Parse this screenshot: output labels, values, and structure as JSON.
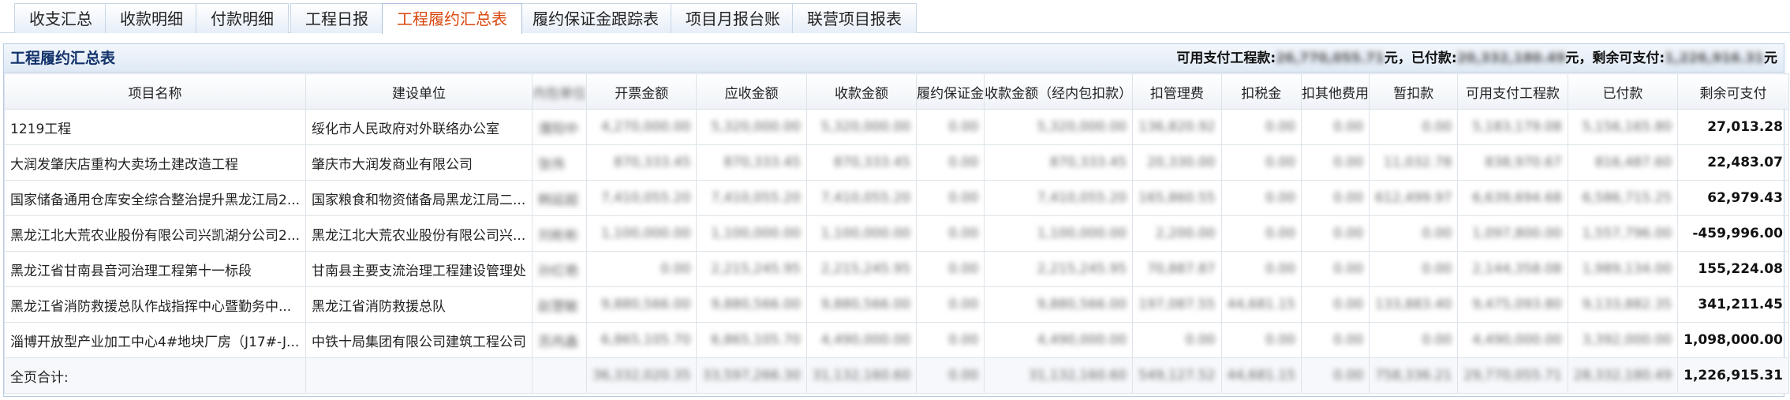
{
  "tabs": [
    {
      "label": "收支汇总",
      "active": false
    },
    {
      "label": "收款明细",
      "active": false
    },
    {
      "label": "付款明细",
      "active": false
    },
    {
      "label": "工程日报",
      "active": false
    },
    {
      "label": "工程履约汇总表",
      "active": true
    },
    {
      "label": "履约保证金跟踪表",
      "active": false
    },
    {
      "label": "项目月报台账",
      "active": false
    },
    {
      "label": "联营项目报表",
      "active": false
    }
  ],
  "panel": {
    "title": "工程履约汇总表",
    "summary": {
      "payable_label": "可用支付工程款:",
      "payable_value": "26,770,055.71",
      "paid_label": "元，已付款:",
      "paid_value": "20,332,180.49",
      "remaining_label": "元，剩余可支付:",
      "remaining_value": "1,226,916.31",
      "unit": "元"
    }
  },
  "table": {
    "columns": [
      "项目名称",
      "建设单位",
      "内包单位",
      "开票金额",
      "应收金额",
      "收款金额",
      "履约保证金",
      "收款金额（经内包扣款）",
      "扣管理费",
      "扣税金",
      "扣其他费用",
      "暂扣款",
      "可用支付工程款",
      "已付款",
      "剩余可支付"
    ],
    "rows": [
      [
        "1219工程",
        "绥化市人民政府对外联络办公室",
        "濮阳中",
        "4,270,000.00",
        "5,320,000.00",
        "5,320,000.00",
        "0.00",
        "5,320,000.00",
        "136,820.92",
        "0.00",
        "0.00",
        "0.00",
        "5,183,179.08",
        "5,156,165.80",
        "27,013.28"
      ],
      [
        "大润发肇庆店重构大卖场土建改造工程",
        "肇庆市大润发商业有限公司",
        "张伟",
        "870,333.45",
        "870,333.45",
        "870,333.45",
        "0.00",
        "870,333.45",
        "20,330.00",
        "0.00",
        "0.00",
        "11,032.78",
        "838,970.67",
        "816,487.60",
        "22,483.07"
      ],
      [
        "国家储备通用仓库安全综合整治提升黑龙江局2...",
        "国家粮食和物资储备局黑龙江局二...",
        "韩延超",
        "7,410,055.20",
        "7,410,055.20",
        "7,410,055.20",
        "0.00",
        "7,410,055.20",
        "165,860.55",
        "0.00",
        "0.00",
        "612,499.97",
        "6,639,694.68",
        "6,586,715.25",
        "62,979.43"
      ],
      [
        "黑龙江北大荒农业股份有限公司兴凯湖分公司2...",
        "黑龙江北大荒农业股份有限公司兴...",
        "刘彬彬",
        "1,100,000.00",
        "1,100,000.00",
        "1,100,000.00",
        "0.00",
        "1,100,000.00",
        "2,200.00",
        "0.00",
        "0.00",
        "0.00",
        "1,097,800.00",
        "1,557,796.00",
        "-459,996.00"
      ],
      [
        "黑龙江省甘南县音河治理工程第十一标段",
        "甘南县主要支流治理工程建设管理处",
        "孙红艳",
        "0.00",
        "2,215,245.95",
        "2,215,245.95",
        "0.00",
        "2,215,245.95",
        "70,887.87",
        "0.00",
        "0.00",
        "0.00",
        "2,144,358.08",
        "1,989,134.00",
        "155,224.08"
      ],
      [
        "黑龙江省消防救援总队作战指挥中心暨勤务中...",
        "黑龙江省消防救援总队",
        "赵慧敏",
        "9,880,566.00",
        "9,880,566.00",
        "9,880,566.00",
        "0.00",
        "9,880,566.00",
        "197,087.55",
        "44,681.15",
        "0.00",
        "133,883.40",
        "9,475,093.80",
        "9,133,882.35",
        "341,211.45"
      ],
      [
        "淄博开放型产业加工中心4#地块厂房（J17#-J...",
        "中铁十局集团有限公司建筑工程公司",
        "苏丙鑫",
        "6,865,105.70",
        "6,865,105.70",
        "4,490,000.00",
        "0.00",
        "4,490,000.00",
        "0.00",
        "0.00",
        "0.00",
        "0.00",
        "4,490,000.00",
        "3,392,000.00",
        "1,098,000.00"
      ]
    ],
    "total": {
      "label": "全页合计:",
      "values": [
        "36,332,020.35",
        "33,597,266.30",
        "31,132,160.60",
        "0.00",
        "31,132,160.60",
        "549,127.52",
        "44,681.15",
        "0.00",
        "758,336.21",
        "29,770,055.71",
        "28,332,180.49",
        "1,226,915.31"
      ]
    }
  }
}
